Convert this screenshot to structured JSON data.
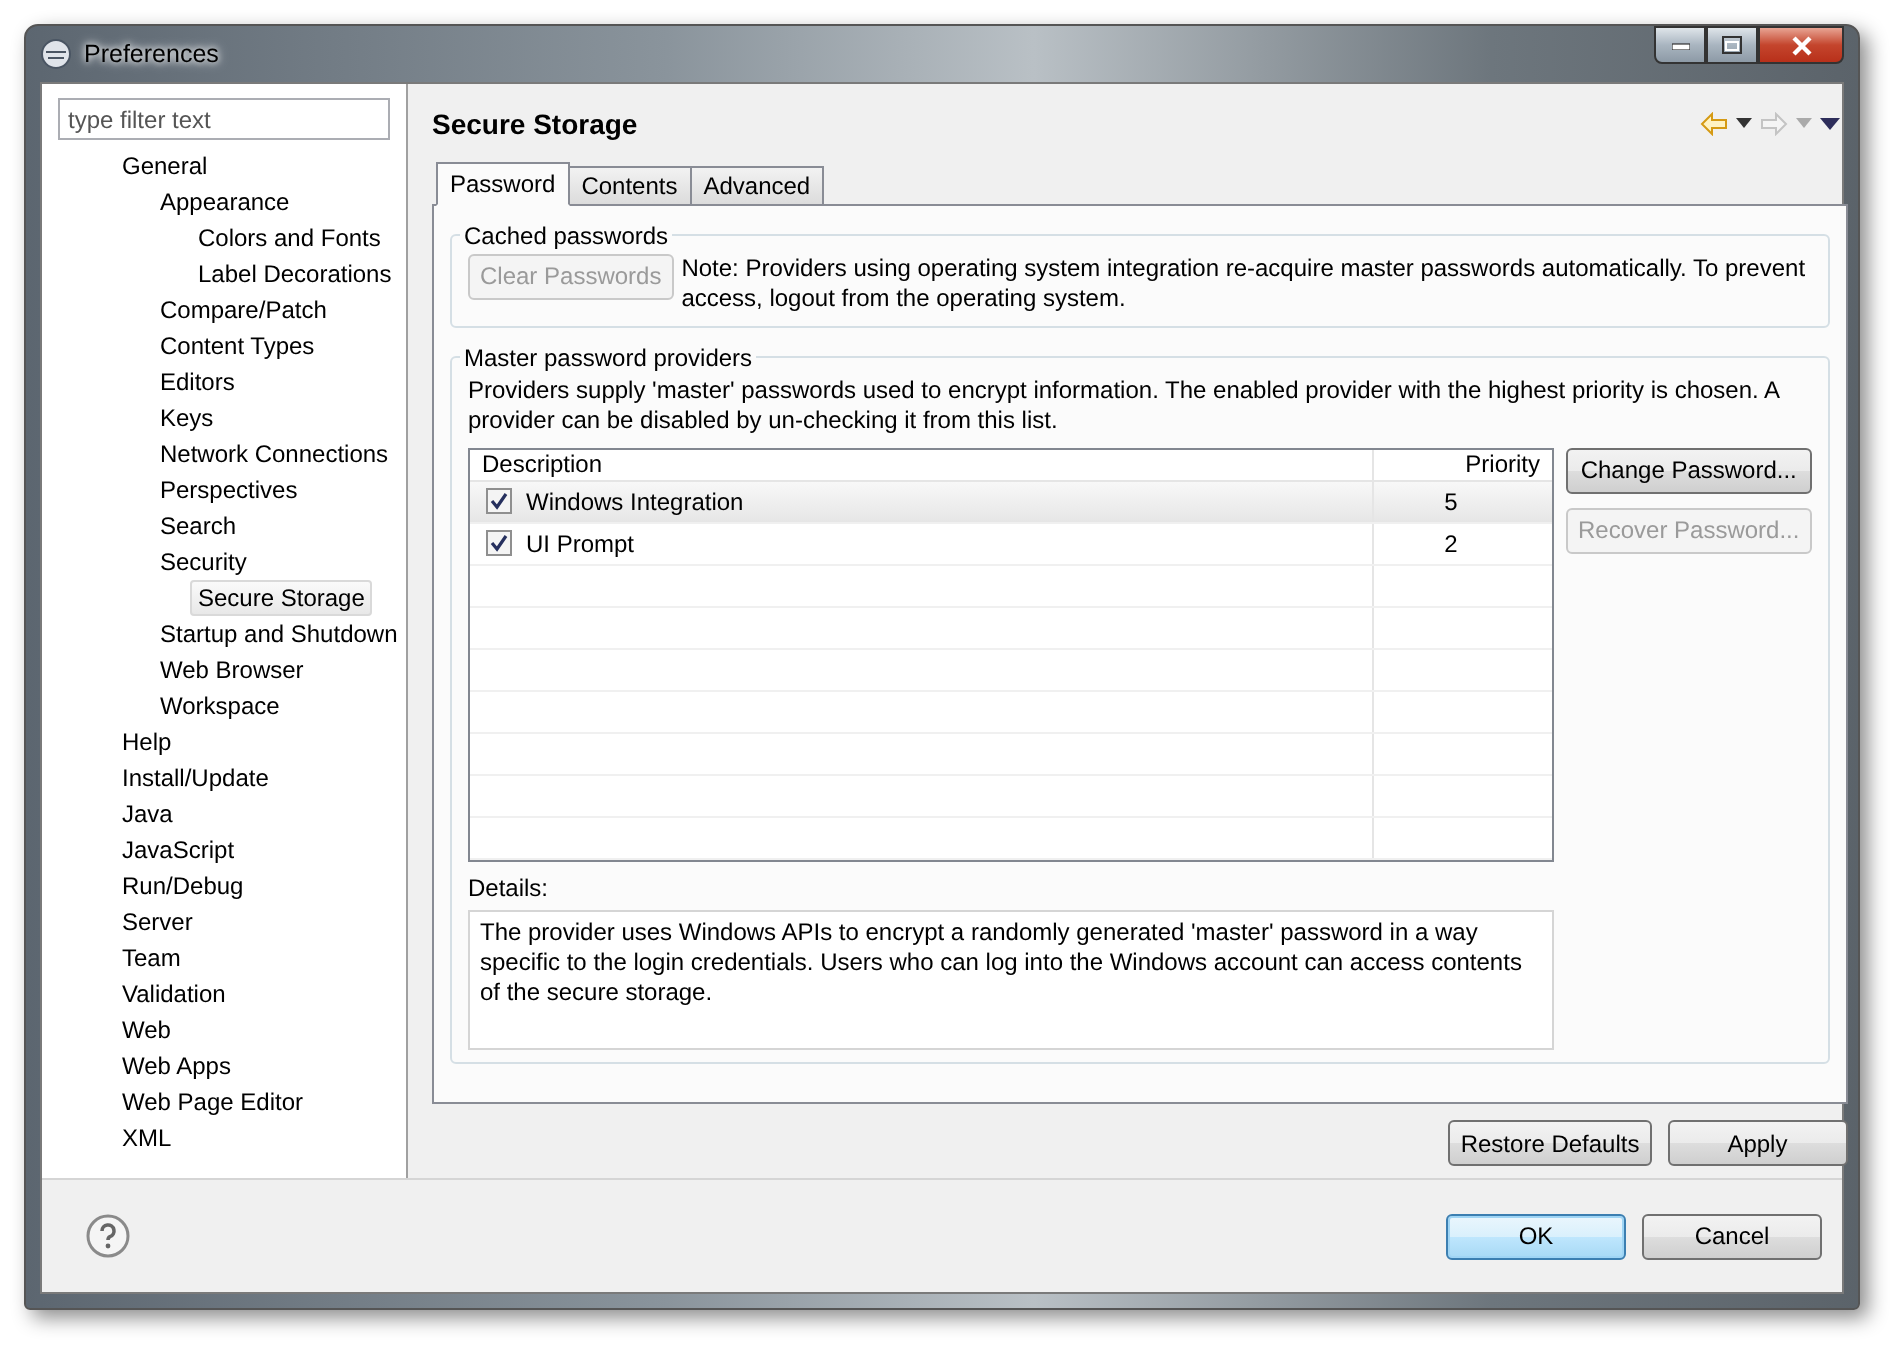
{
  "window": {
    "title": "Preferences"
  },
  "filter": {
    "placeholder": "type filter text"
  },
  "tree": [
    {
      "label": "General",
      "selected": false,
      "children": [
        {
          "label": "Appearance",
          "selected": false,
          "children": [
            {
              "label": "Colors and Fonts",
              "selected": false
            },
            {
              "label": "Label Decorations",
              "selected": false
            }
          ]
        },
        {
          "label": "Compare/Patch",
          "selected": false
        },
        {
          "label": "Content Types",
          "selected": false
        },
        {
          "label": "Editors",
          "selected": false
        },
        {
          "label": "Keys",
          "selected": false
        },
        {
          "label": "Network Connections",
          "selected": false
        },
        {
          "label": "Perspectives",
          "selected": false
        },
        {
          "label": "Search",
          "selected": false
        },
        {
          "label": "Security",
          "selected": false,
          "children": [
            {
              "label": "Secure Storage",
              "selected": true
            }
          ]
        },
        {
          "label": "Startup and Shutdown",
          "selected": false
        },
        {
          "label": "Web Browser",
          "selected": false
        },
        {
          "label": "Workspace",
          "selected": false
        }
      ]
    },
    {
      "label": "Help",
      "selected": false
    },
    {
      "label": "Install/Update",
      "selected": false
    },
    {
      "label": "Java",
      "selected": false
    },
    {
      "label": "JavaScript",
      "selected": false
    },
    {
      "label": "Run/Debug",
      "selected": false
    },
    {
      "label": "Server",
      "selected": false
    },
    {
      "label": "Team",
      "selected": false
    },
    {
      "label": "Validation",
      "selected": false
    },
    {
      "label": "Web",
      "selected": false
    },
    {
      "label": "Web Apps",
      "selected": false
    },
    {
      "label": "Web Page Editor",
      "selected": false
    },
    {
      "label": "XML",
      "selected": false
    }
  ],
  "page": {
    "title": "Secure Storage"
  },
  "tabs": [
    {
      "label": "Password",
      "selected": true
    },
    {
      "label": "Contents",
      "selected": false
    },
    {
      "label": "Advanced",
      "selected": false
    }
  ],
  "cached": {
    "title": "Cached passwords",
    "button": {
      "label": "Clear Passwords",
      "disabled": true
    },
    "note": "Note: Providers using operating system integration re-acquire master passwords automatically. To prevent access, logout from the operating system."
  },
  "providers": {
    "title": "Master password providers",
    "intro": "Providers supply 'master' passwords used to encrypt information. The enabled provider with the highest priority is chosen. A provider can be disabled by un-checking it from this list.",
    "columns": [
      "Description",
      "Priority"
    ],
    "rows": [
      {
        "description": "Windows Integration",
        "priority": "5",
        "checked": true,
        "selected": true
      },
      {
        "description": "UI Prompt",
        "priority": "2",
        "checked": true,
        "selected": false
      }
    ],
    "buttons": [
      {
        "label": "Change Password...",
        "disabled": false
      },
      {
        "label": "Recover Password...",
        "disabled": true
      }
    ],
    "details_label": "Details:",
    "details": "The provider uses Windows APIs to encrypt a randomly generated 'master' password in a way specific to the login credentials. Users who can log into the Windows account can access contents of the secure storage."
  },
  "page_buttons": [
    "Restore Defaults",
    "Apply"
  ],
  "dialog_buttons": [
    {
      "label": "OK",
      "default": true
    },
    {
      "label": "Cancel",
      "default": false
    }
  ]
}
